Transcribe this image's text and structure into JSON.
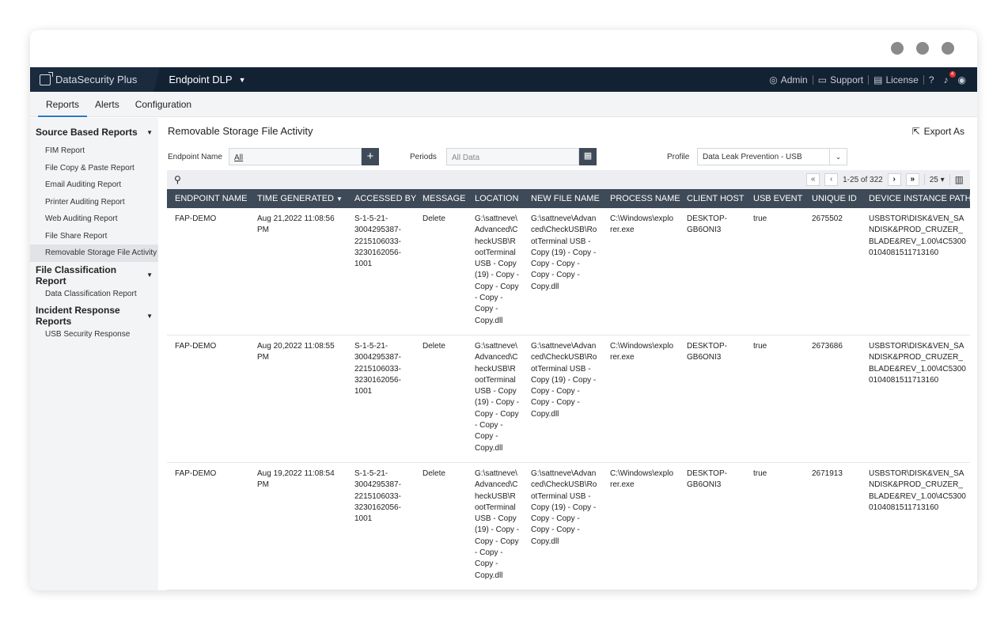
{
  "brand": {
    "name": "DataSecurity Plus"
  },
  "module": {
    "name": "Endpoint DLP"
  },
  "topright": {
    "admin": "Admin",
    "support": "Support",
    "license": "License",
    "help": "?",
    "notif_count": "4"
  },
  "tabs": [
    "Reports",
    "Alerts",
    "Configuration"
  ],
  "sidebar": {
    "sections": [
      {
        "title": "Source Based Reports",
        "items": [
          "FIM Report",
          "File Copy & Paste Report",
          "Email Auditing Report",
          "Printer Auditing Report",
          "Web Auditing Report",
          "File Share Report",
          "Removable Storage File Activity"
        ]
      },
      {
        "title": "File Classification Report",
        "items": [
          "Data Classification Report"
        ]
      },
      {
        "title": "Incident Response Reports",
        "items": [
          "USB Security Response"
        ]
      }
    ]
  },
  "page": {
    "title": "Removable Storage File Activity",
    "export": "Export As"
  },
  "filters": {
    "endpoint_label": "Endpoint Name",
    "endpoint_value": "All",
    "periods_label": "Periods",
    "periods_value": "All Data",
    "profile_label": "Profile",
    "profile_value": "Data Leak Prevention - USB"
  },
  "pager": {
    "range": "1-25 of 322",
    "per_page": "25"
  },
  "table": {
    "headers": [
      "ENDPOINT NAME",
      "TIME GENERATED",
      "ACCESSED BY",
      "MESSAGE",
      "LOCATION",
      "NEW FILE NAME",
      "PROCESS NAME",
      "CLIENT HOST",
      "USB EVENT",
      "UNIQUE ID",
      "DEVICE INSTANCE PATH"
    ],
    "rows": [
      [
        "FAP-DEMO",
        "Aug 21,2022 11:08:56 PM",
        "S-1-5-21-3004295387-2215106033-3230162056-1001",
        "Delete",
        "G:\\sattneve\\Advanced\\CheckUSB\\RootTerminal USB - Copy (19) - Copy - Copy - Copy - Copy - Copy - Copy.dll",
        "G:\\sattneve\\Advanced\\CheckUSB\\RootTerminal USB - Copy (19) - Copy - Copy - Copy - Copy - Copy - Copy.dll",
        "C:\\Windows\\explorer.exe",
        "DESKTOP-GB6ONI3",
        "true",
        "2675502",
        "USBSTOR\\DISK&VEN_SANDISK&PROD_CRUZER_BLADE&REV_1.00\\4C53000104081511713160"
      ],
      [
        "FAP-DEMO",
        "Aug 20,2022 11:08:55 PM",
        "S-1-5-21-3004295387-2215106033-3230162056-1001",
        "Delete",
        "G:\\sattneve\\Advanced\\CheckUSB\\RootTerminal USB - Copy (19) - Copy - Copy - Copy - Copy - Copy - Copy.dll",
        "G:\\sattneve\\Advanced\\CheckUSB\\RootTerminal USB - Copy (19) - Copy - Copy - Copy - Copy - Copy - Copy.dll",
        "C:\\Windows\\explorer.exe",
        "DESKTOP-GB6ONI3",
        "true",
        "2673686",
        "USBSTOR\\DISK&VEN_SANDISK&PROD_CRUZER_BLADE&REV_1.00\\4C53000104081511713160"
      ],
      [
        "FAP-DEMO",
        "Aug 19,2022 11:08:54 PM",
        "S-1-5-21-3004295387-2215106033-3230162056-1001",
        "Delete",
        "G:\\sattneve\\Advanced\\CheckUSB\\RootTerminal USB - Copy (19) - Copy - Copy - Copy - Copy - Copy - Copy.dll",
        "G:\\sattneve\\Advanced\\CheckUSB\\RootTerminal USB - Copy (19) - Copy - Copy - Copy - Copy - Copy - Copy.dll",
        "C:\\Windows\\explorer.exe",
        "DESKTOP-GB6ONI3",
        "true",
        "2671913",
        "USBSTOR\\DISK&VEN_SANDISK&PROD_CRUZER_BLADE&REV_1.00\\4C53000104081511713160"
      ]
    ]
  },
  "colors": {
    "nav_bg": "#132233",
    "header_bg": "#3e4a57",
    "accent": "#2d78c9",
    "sidebar_bg": "#f3f4f6"
  }
}
